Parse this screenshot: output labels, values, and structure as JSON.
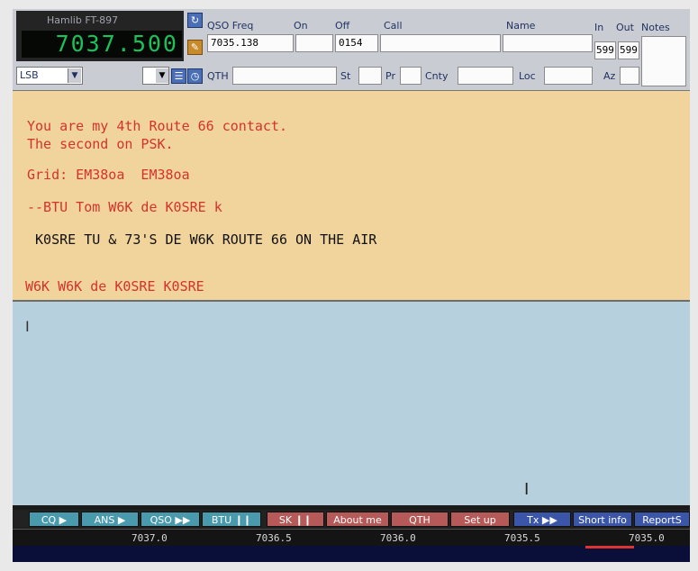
{
  "rig": {
    "name": "Hamlib FT-897",
    "frequency": "7037.500",
    "mode": "LSB"
  },
  "qso": {
    "freq_label": "QSO Freq",
    "freq_value": "7035.138",
    "on_label": "On",
    "on_value": "",
    "off_label": "Off",
    "off_value": "0154",
    "call_label": "Call",
    "call_value": "",
    "name_label": "Name",
    "name_value": "",
    "in_label": "In",
    "in_value": "599",
    "out_label": "Out",
    "out_value": "599",
    "notes_label": "Notes",
    "qth_label": "QTH",
    "st_label": "St",
    "pr_label": "Pr",
    "cnty_label": "Cnty",
    "loc_label": "Loc",
    "az_label": "Az"
  },
  "rx_text": [
    "You are my 4th Route 66 contact.",
    "The second on PSK.",
    "Grid: EM38oa  EM38oa",
    "--BTU Tom W6K de K0SRE k",
    " K0SRE TU & 73'S DE W6K ROUTE 66 ON THE AIR",
    "W6K W6K de K0SRE K0SRE"
  ],
  "macros": [
    "CQ ▶",
    "ANS ▶",
    "QSO ▶▶",
    "BTU ❙❙",
    "SK ❙❙",
    "About me",
    "QTH",
    "Set up",
    "Tx ▶▶",
    "Short info",
    "ReportS"
  ],
  "scale_ticks": [
    "7037.0",
    "7036.5",
    "7036.0",
    "7035.5",
    "7035.0"
  ],
  "colors": {
    "rx_bg": "#f1d49c",
    "tx_bg": "#b6d1dd",
    "rx_text": "#d4332c",
    "freq_display": "#19c25a"
  }
}
